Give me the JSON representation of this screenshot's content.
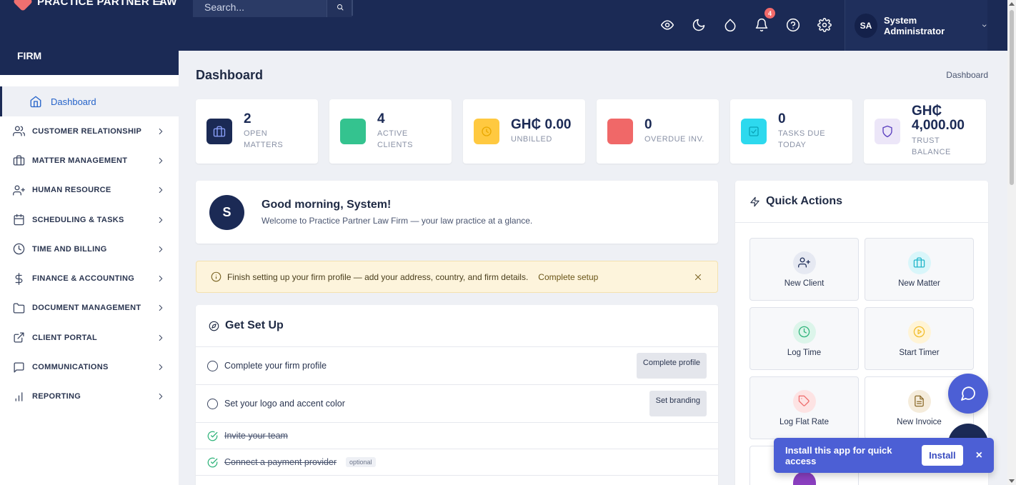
{
  "brand": {
    "name": "PRACTICE PARTNER LAW"
  },
  "search": {
    "placeholder": "Search..."
  },
  "notifications": {
    "count": "4"
  },
  "user": {
    "initials": "SA",
    "name": "System Administrator"
  },
  "sidebar": {
    "section": "FIRM",
    "active": "Dashboard",
    "items": [
      {
        "label": "CUSTOMER RELATIONSHIP",
        "icon": "users-icon"
      },
      {
        "label": "MATTER MANAGEMENT",
        "icon": "briefcase-icon"
      },
      {
        "label": "HUMAN RESOURCE",
        "icon": "user-plus-icon"
      },
      {
        "label": "SCHEDULING & TASKS",
        "icon": "calendar-icon"
      },
      {
        "label": "TIME AND BILLING",
        "icon": "clock-icon"
      },
      {
        "label": "FINANCE & ACCOUNTING",
        "icon": "dollar-icon"
      },
      {
        "label": "DOCUMENT MANAGEMENT",
        "icon": "folder-icon"
      },
      {
        "label": "CLIENT PORTAL",
        "icon": "external-link-icon"
      },
      {
        "label": "COMMUNICATIONS",
        "icon": "message-icon"
      },
      {
        "label": "REPORTING",
        "icon": "bar-chart-icon"
      }
    ]
  },
  "page": {
    "title": "Dashboard",
    "breadcrumb": "Dashboard"
  },
  "stats": [
    {
      "value": "2",
      "label": "OPEN MATTERS",
      "color": "#1b2a55"
    },
    {
      "value": "4",
      "label": "ACTIVE CLIENTS",
      "color": "#34c38f"
    },
    {
      "value": "GH₵ 0.00",
      "label": "UNBILLED",
      "color": "#ffc940"
    },
    {
      "value": "0",
      "label": "OVERDUE INV.",
      "color": "#f06868"
    },
    {
      "value": "0",
      "label": "TASKS DUE TODAY",
      "color": "#2dd9ee"
    },
    {
      "value": "GH₵ 4,000.00",
      "label": "TRUST BALANCE",
      "color": "#ece6f8"
    }
  ],
  "welcome": {
    "initial": "S",
    "title": "Good morning, System!",
    "subtitle": "Welcome to Practice Partner Law Firm — your law practice at a glance."
  },
  "alert": {
    "text": "Finish setting up your firm profile — add your address, country, and firm details.",
    "link": "Complete setup"
  },
  "setup": {
    "title": "Get Set Up",
    "rows": [
      {
        "label": "Complete your firm profile",
        "done": false,
        "button": "Complete profile"
      },
      {
        "label": "Set your logo and accent color",
        "done": false,
        "button": "Set branding"
      },
      {
        "label": "Invite your team",
        "done": true
      },
      {
        "label": "Connect a payment provider",
        "done": true,
        "tag": "optional"
      }
    ]
  },
  "quick_actions": {
    "title": "Quick Actions",
    "tiles": [
      {
        "label": "New Client",
        "bg": "#e6e9f2",
        "fg": "#1b2a55"
      },
      {
        "label": "New Matter",
        "bg": "#d9f6fa",
        "fg": "#1fb5c9"
      },
      {
        "label": "Log Time",
        "bg": "#dcf5ea",
        "fg": "#2fb37a"
      },
      {
        "label": "Start Timer",
        "bg": "#fff4d6",
        "fg": "#f2bd2c"
      },
      {
        "label": "Log Flat Rate",
        "bg": "#fde3e3",
        "fg": "#ee6b6b"
      },
      {
        "label": "New Invoice",
        "bg": "#f5ecdb",
        "fg": "#8b6a2a"
      }
    ]
  },
  "install_banner": {
    "text": "Install this app for quick access",
    "button": "Install",
    "close": "×"
  }
}
